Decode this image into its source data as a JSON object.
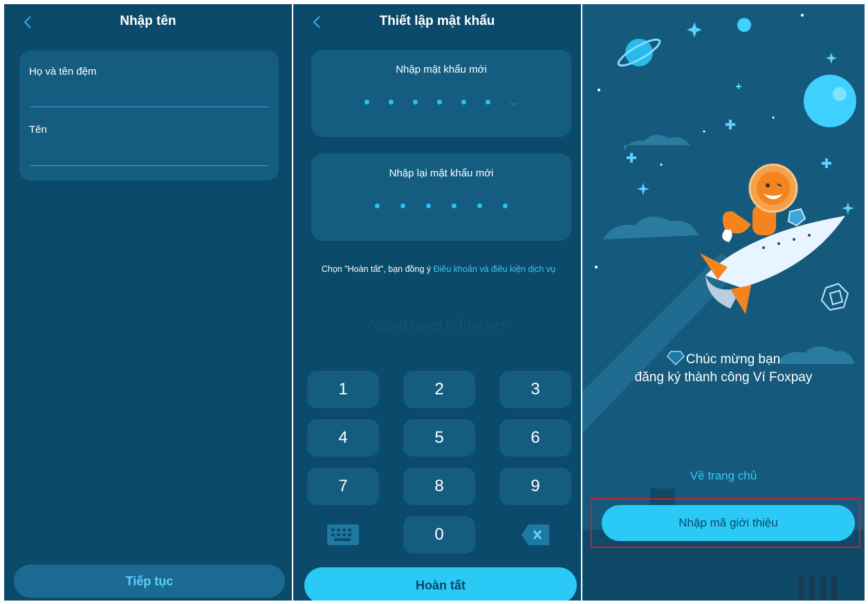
{
  "name_screen": {
    "title": "Nhập tên",
    "fields": {
      "middle_name_label": "Họ và tên đệm",
      "first_name_label": "Tên"
    },
    "continue_button": "Tiếp tục"
  },
  "password_screen": {
    "title": "Thiết lập mật khẩu",
    "new_password_label": "Nhập mật khẩu mới",
    "confirm_password_label": "Nhập lại mật khẩu mới",
    "terms_prefix": "Chọn \"Hoàn tất\", bạn đồng ý",
    "terms_link": "Điều khoản và điều kiện dịch vụ",
    "watermark": "NganHangOnline.net",
    "keypad": [
      "1",
      "2",
      "3",
      "4",
      "5",
      "6",
      "7",
      "8",
      "9",
      "0"
    ],
    "done_button": "Hoàn tất"
  },
  "success_screen": {
    "message_line1": "Chúc mừng bạn",
    "message_line2": "đăng ký thành công Ví Foxpay",
    "home_link": "Về trang chủ",
    "referral_button": "Nhập mã giới thiệu"
  },
  "colors": {
    "background": "#0b4a6a",
    "card": "#155d80",
    "accent": "#2bcaf6",
    "link": "#3fc6f2",
    "highlight_border": "#cc1f2a"
  }
}
